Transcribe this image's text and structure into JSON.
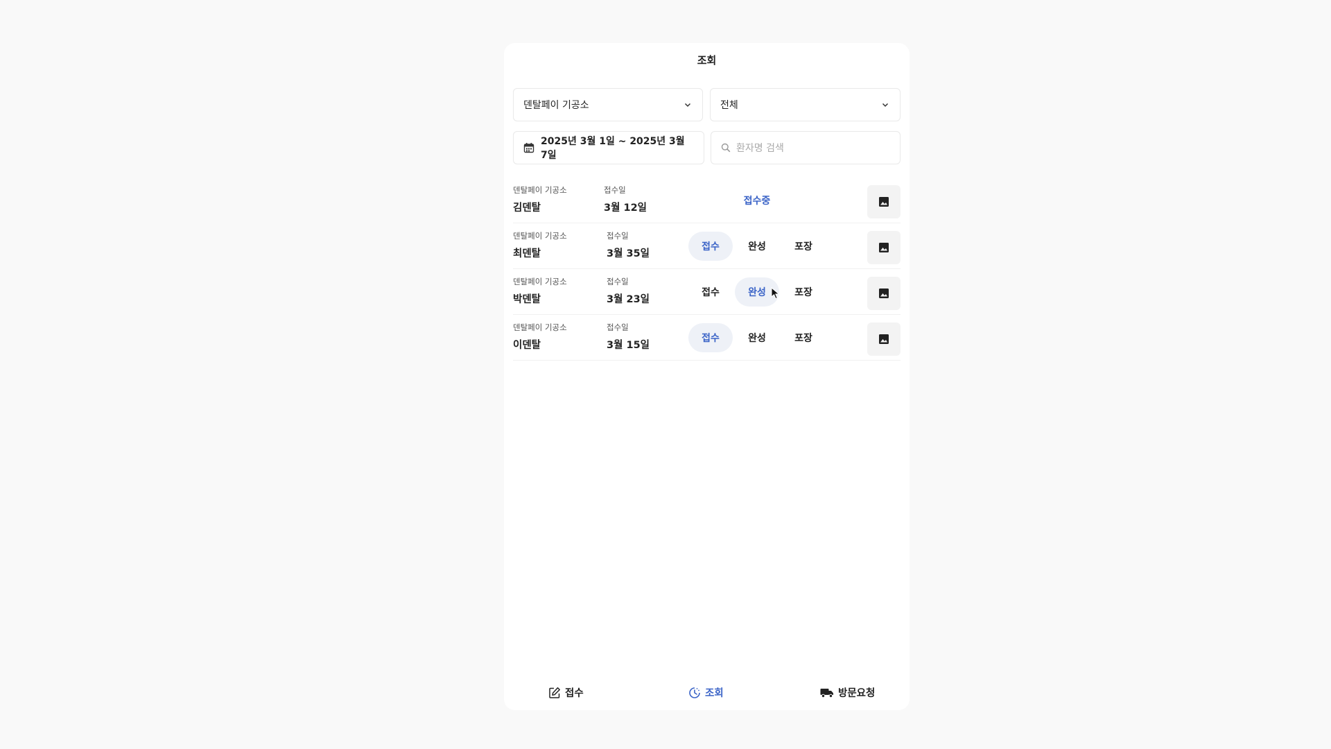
{
  "header": {
    "title": "조회"
  },
  "filters": {
    "lab_select": "덴탈페이 기공소",
    "status_select": "전체",
    "date_range": "2025년 3월 1일 ~ 2025년 3월 7일",
    "search_placeholder": "환자명 검색"
  },
  "rows": [
    {
      "lab": "덴탈페이 기공소",
      "patient": "김덴탈",
      "date_label": "접수일",
      "date": "3월 12일",
      "status_text": "접수중"
    },
    {
      "lab": "덴탈페이 기공소",
      "patient": "최덴탈",
      "date_label": "접수일",
      "date": "3월 35일",
      "stages": [
        "접수",
        "완성",
        "포장"
      ],
      "active_stage": 0
    },
    {
      "lab": "덴탈페이 기공소",
      "patient": "박덴탈",
      "date_label": "접수일",
      "date": "3월 23일",
      "stages": [
        "접수",
        "완성",
        "포장"
      ],
      "active_stage": 1
    },
    {
      "lab": "덴탈페이 기공소",
      "patient": "이덴탈",
      "date_label": "접수일",
      "date": "3월 15일",
      "stages": [
        "접수",
        "완성",
        "포장"
      ],
      "active_stage": 0
    }
  ],
  "bottom_nav": {
    "items": [
      {
        "label": "접수",
        "icon": "edit-icon"
      },
      {
        "label": "조회",
        "icon": "history-icon",
        "active": true
      },
      {
        "label": "방문요청",
        "icon": "truck-icon"
      }
    ]
  },
  "colors": {
    "accent": "#3a63c7",
    "active_pill_bg": "#eef1f7",
    "background": "#f9f9f9"
  }
}
